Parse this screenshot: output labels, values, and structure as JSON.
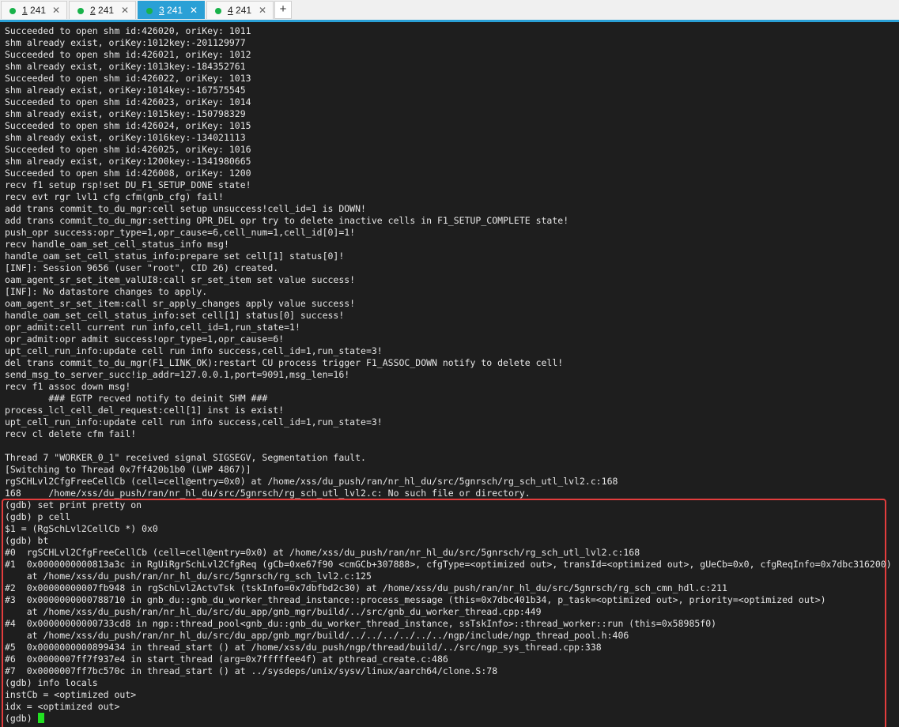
{
  "tabs": [
    {
      "num": "1",
      "label": "241",
      "active": false,
      "close": "✕"
    },
    {
      "num": "2",
      "label": "241",
      "active": false,
      "close": "✕"
    },
    {
      "num": "3",
      "label": "241",
      "active": true,
      "close": "✕"
    },
    {
      "num": "4",
      "label": "241",
      "active": false,
      "close": "✕"
    }
  ],
  "new_tab_label": "+",
  "accent_color": "#2aa0d6",
  "highlight_color": "#e33d3d",
  "terminal_lines": [
    "Succeeded to open shm id:426020, oriKey: 1011",
    "shm already exist, oriKey:1012key:-201129977",
    "Succeeded to open shm id:426021, oriKey: 1012",
    "shm already exist, oriKey:1013key:-184352761",
    "Succeeded to open shm id:426022, oriKey: 1013",
    "shm already exist, oriKey:1014key:-167575545",
    "Succeeded to open shm id:426023, oriKey: 1014",
    "shm already exist, oriKey:1015key:-150798329",
    "Succeeded to open shm id:426024, oriKey: 1015",
    "shm already exist, oriKey:1016key:-134021113",
    "Succeeded to open shm id:426025, oriKey: 1016",
    "shm already exist, oriKey:1200key:-1341980665",
    "Succeeded to open shm id:426008, oriKey: 1200",
    "recv f1 setup rsp!set DU_F1_SETUP_DONE state!",
    "recv evt rgr lvl1 cfg cfm(gnb_cfg) fail!",
    "add trans commit_to_du_mgr:cell setup unsuccess!cell_id=1 is DOWN!",
    "add trans commit_to_du_mgr:setting OPR_DEL opr try to delete inactive cells in F1_SETUP_COMPLETE state!",
    "push_opr success:opr_type=1,opr_cause=6,cell_num=1,cell_id[0]=1!",
    "recv handle_oam_set_cell_status_info msg!",
    "handle_oam_set_cell_status_info:prepare set cell[1] status[0]!",
    "[INF]: Session 9656 (user \"root\", CID 26) created.",
    "oam_agent_sr_set_item_valUI8:call sr_set_item set value success!",
    "[INF]: No datastore changes to apply.",
    "oam_agent_sr_set_item:call sr_apply_changes apply value success!",
    "handle_oam_set_cell_status_info:set cell[1] status[0] success!",
    "opr_admit:cell current run info,cell_id=1,run_state=1!",
    "opr_admit:opr admit success!opr_type=1,opr_cause=6!",
    "upt_cell_run_info:update cell run info success,cell_id=1,run_state=3!",
    "del trans commit_to_du_mgr(F1_LINK_OK):restart CU process trigger F1_ASSOC_DOWN notify to delete cell!",
    "send_msg_to_server_succ!ip_addr=127.0.0.1,port=9091,msg_len=16!",
    "recv f1 assoc down msg!",
    "        ### EGTP recved notify to deinit SHM ###",
    "process_lcl_cell_del_request:cell[1] inst is exist!",
    "upt_cell_run_info:update cell run info success,cell_id=1,run_state=3!",
    "recv cl delete cfm fail!",
    "",
    "Thread 7 \"WORKER_0_1\" received signal SIGSEGV, Segmentation fault.",
    "[Switching to Thread 0x7ff420b1b0 (LWP 4867)]",
    "rgSCHLvl2CfgFreeCellCb (cell=cell@entry=0x0) at /home/xss/du_push/ran/nr_hl_du/src/5gnrsch/rg_sch_utl_lvl2.c:168",
    "168     /home/xss/du_push/ran/nr_hl_du/src/5gnrsch/rg_sch_utl_lvl2.c: No such file or directory.",
    "(gdb) set print pretty on",
    "(gdb) p cell",
    "$1 = (RgSchLvl2CellCb *) 0x0",
    "(gdb) bt",
    "#0  rgSCHLvl2CfgFreeCellCb (cell=cell@entry=0x0) at /home/xss/du_push/ran/nr_hl_du/src/5gnrsch/rg_sch_utl_lvl2.c:168",
    "#1  0x0000000000813a3c in RgUiRgrSchLvl2CfgReq (gCb=0xe67f90 <cmGCb+307888>, cfgType=<optimized out>, transId=<optimized out>, gUeCb=0x0, cfgReqInfo=0x7dbc316200)",
    "    at /home/xss/du_push/ran/nr_hl_du/src/5gnrsch/rg_sch_lvl2.c:125",
    "#2  0x00000000007fb948 in rgSchLvl2ActvTsk (tskInfo=0x7dbfbd2c30) at /home/xss/du_push/ran/nr_hl_du/src/5gnrsch/rg_sch_cmn_hdl.c:211",
    "#3  0x0000000000788710 in gnb_du::gnb_du_worker_thread_instance::process_message (this=0x7dbc401b34, p_task=<optimized out>, priority=<optimized out>)",
    "    at /home/xss/du_push/ran/nr_hl_du/src/du_app/gnb_mgr/build/../src/gnb_du_worker_thread.cpp:449",
    "#4  0x00000000000733cd8 in ngp::thread_pool<gnb_du::gnb_du_worker_thread_instance, ssTskInfo>::thread_worker::run (this=0x58985f0)",
    "    at /home/xss/du_push/ran/nr_hl_du/src/du_app/gnb_mgr/build/../../../../../../ngp/include/ngp_thread_pool.h:406",
    "#5  0x0000000000899434 in thread_start () at /home/xss/du_push/ngp/thread/build/../src/ngp_sys_thread.cpp:338",
    "#6  0x0000007ff7f937e4 in start_thread (arg=0x7fffffee4f) at pthread_create.c:486",
    "#7  0x0000007ff7bc570c in thread_start () at ../sysdeps/unix/sysv/linux/aarch64/clone.S:78",
    "(gdb) info locals",
    "instCb = <optimized out>",
    "idx = <optimized out>"
  ],
  "prompt": "(gdb) "
}
